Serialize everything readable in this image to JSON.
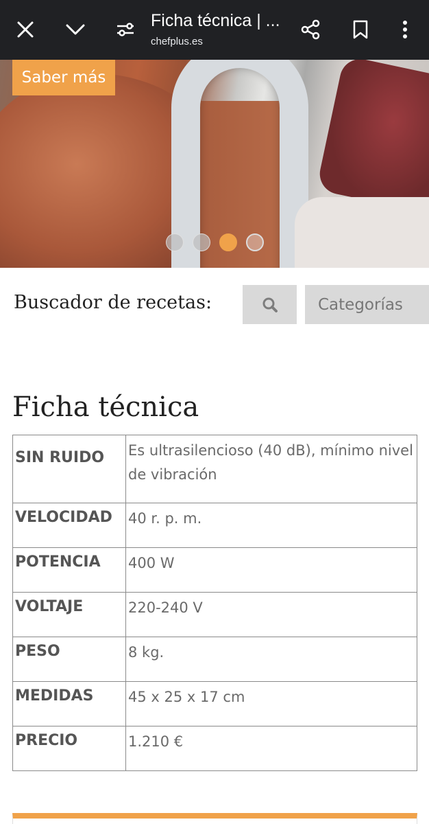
{
  "browser": {
    "title": "Ficha técnica | ...",
    "domain": "chefplus.es",
    "icons": [
      "close-icon",
      "chevron-down-icon",
      "tune-icon",
      "share-icon",
      "bookmark-icon",
      "more-vert-icon"
    ]
  },
  "hero": {
    "button_label": "Saber más",
    "slides_count": 4,
    "active_slide": 3,
    "accent_color": "#f0a24a"
  },
  "search": {
    "label": "Buscador de recetas:",
    "categories_label": "Categorías"
  },
  "section_title": "Ficha técnica",
  "specs": [
    {
      "key": "SIN RUIDO",
      "value": "Es ultrasilencioso (40 dB), mínimo nivel de vibración"
    },
    {
      "key": "VELOCIDAD",
      "value": "40 r. p. m."
    },
    {
      "key": "POTENCIA",
      "value": "400 W"
    },
    {
      "key": "VOLTAJE",
      "value": "220-240 V"
    },
    {
      "key": "PESO",
      "value": "8 kg."
    },
    {
      "key": "MEDIDAS",
      "value": "45 x 25 x 17 cm"
    },
    {
      "key": "PRECIO",
      "value": "1.210 €"
    }
  ]
}
